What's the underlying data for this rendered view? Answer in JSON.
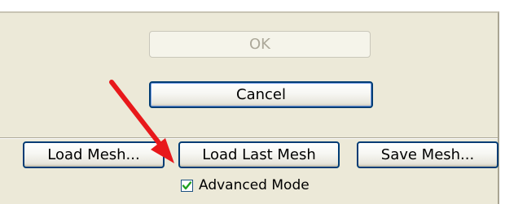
{
  "dialog": {
    "ok_label": "OK",
    "cancel_label": "Cancel",
    "load_mesh_label": "Load Mesh...",
    "load_last_mesh_label": "Load Last Mesh",
    "save_mesh_label": "Save Mesh...",
    "advanced_mode_label": "Advanced Mode",
    "advanced_mode_checked": true
  },
  "colors": {
    "panel_bg": "#ece9d8",
    "button_border": "#003c74",
    "checkmark": "#21a121",
    "annotation_arrow": "#e8181b"
  },
  "icons": {
    "check": "checkmark-icon",
    "annotation": "red-arrow-annotation"
  }
}
